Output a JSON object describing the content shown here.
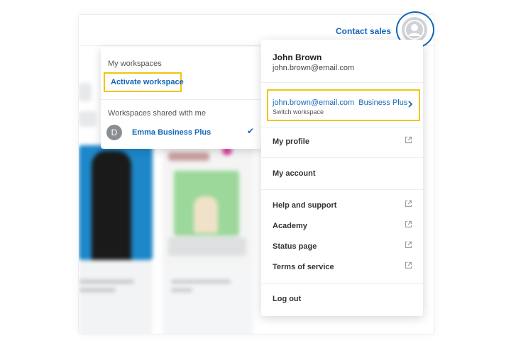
{
  "header": {
    "contact_sales": "Contact sales"
  },
  "workspace_menu": {
    "my_workspaces_heading": "My workspaces",
    "activate_label": "Activate workspace",
    "shared_heading": "Workspaces shared with me",
    "shared_items": [
      {
        "initial": "D",
        "name": "Emma Business Plus",
        "checked": true
      }
    ]
  },
  "profile_menu": {
    "name": "John Brown",
    "email": "john.brown@email.com",
    "workspace": {
      "email": "john.brown@email.com",
      "plan": "Business Plus",
      "subtitle": "Switch workspace"
    },
    "items": [
      {
        "label": "My profile",
        "external": true
      },
      {
        "label": "My account",
        "external": false
      },
      {
        "label": "Help and support",
        "external": true
      },
      {
        "label": "Academy",
        "external": true
      },
      {
        "label": "Status page",
        "external": true
      },
      {
        "label": "Terms of service",
        "external": true
      },
      {
        "label": "Log out",
        "external": false
      }
    ]
  },
  "colors": {
    "accent": "#1466b8",
    "highlight": "#f1c40f",
    "text": "#222222"
  }
}
